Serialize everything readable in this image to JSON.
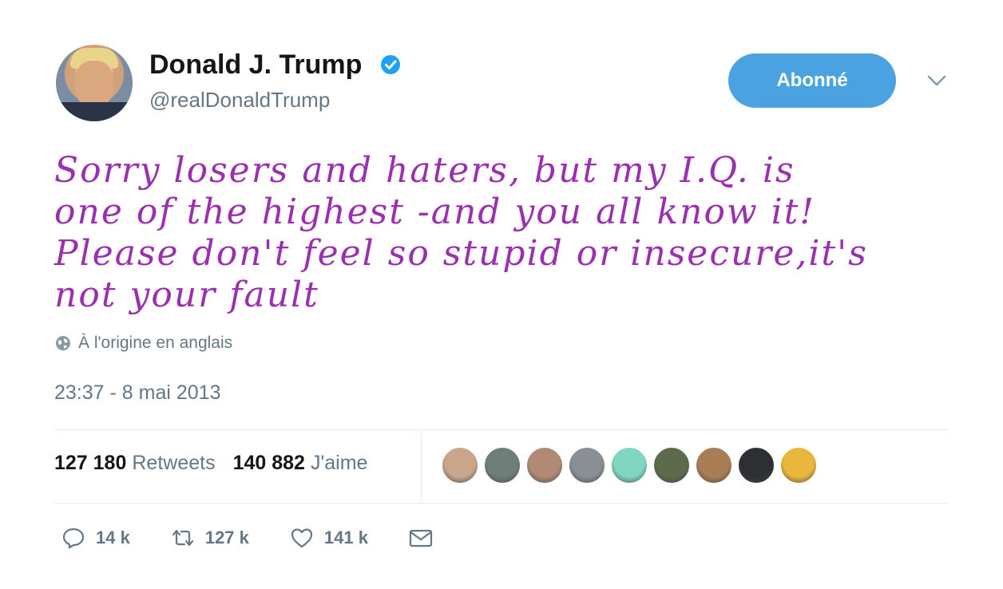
{
  "author": {
    "name": "Donald J. Trump",
    "handle": "@realDonaldTrump",
    "verified": true
  },
  "follow_button": {
    "label": "Abonné"
  },
  "tweet": {
    "lines": [
      "Sorry losers and haters, but my I.Q. is",
      "one of the highest -and you all know it!",
      "Please don't feel so stupid or insecure,it's",
      "not your fault"
    ],
    "text_color": "#9a2fb0"
  },
  "translation": {
    "label": "À l'origine en anglais",
    "icon": "globe-icon"
  },
  "timestamp": "23:37 - 8 mai 2013",
  "stats": {
    "retweets_count": "127 180",
    "retweets_label": "Retweets",
    "likes_count": "140 882",
    "likes_label": "J'aime"
  },
  "likers": [
    {
      "color": "#c9a58c"
    },
    {
      "color": "#6d7f78"
    },
    {
      "color": "#b08a74"
    },
    {
      "color": "#8a8f93"
    },
    {
      "color": "#7fd6c1"
    },
    {
      "color": "#5c6b4a"
    },
    {
      "color": "#a97d56"
    },
    {
      "color": "#2d2f33"
    },
    {
      "color": "#e8b73c"
    }
  ],
  "actions": {
    "reply_count": "14 k",
    "retweet_count": "127 k",
    "like_count": "141 k"
  },
  "colors": {
    "accent": "#4aa3e0",
    "muted": "#657786"
  }
}
